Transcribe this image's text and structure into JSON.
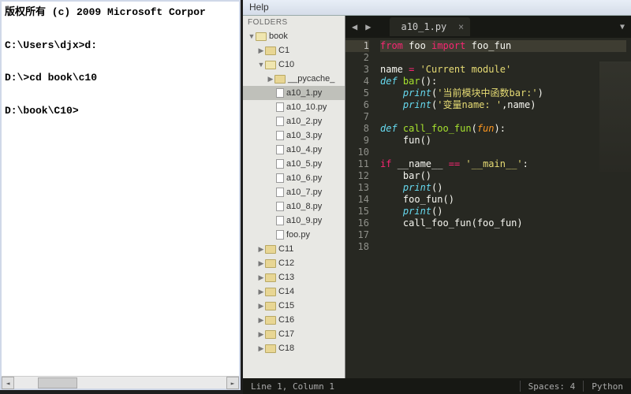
{
  "terminal": {
    "line1": "版权所有 (c) 2009 Microsoft Corpor",
    "line2": "C:\\Users\\djx>d:",
    "line3": "D:\\>cd book\\c10",
    "line4": "D:\\book\\C10>"
  },
  "menu": {
    "help": "Help"
  },
  "sidebar": {
    "header": "FOLDERS",
    "folders": {
      "root": "book",
      "c1": "C1",
      "c10": "C10",
      "pycache": "__pycache_",
      "c11": "C11",
      "c12": "C12",
      "c13": "C13",
      "c14": "C14",
      "c15": "C15",
      "c16": "C16",
      "c17": "C17",
      "c18": "C18"
    },
    "files": {
      "a1": "a10_1.py",
      "a10": "a10_10.py",
      "a2": "a10_2.py",
      "a3": "a10_3.py",
      "a4": "a10_4.py",
      "a5": "a10_5.py",
      "a6": "a10_6.py",
      "a7": "a10_7.py",
      "a8": "a10_8.py",
      "a9": "a10_9.py",
      "foo": "foo.py"
    }
  },
  "tab": {
    "title": "a10_1.py",
    "nav_prev": "◀",
    "nav_next": "▶",
    "overflow": "▼"
  },
  "gutter": [
    "1",
    "2",
    "3",
    "4",
    "5",
    "6",
    "7",
    "8",
    "9",
    "10",
    "11",
    "12",
    "13",
    "14",
    "15",
    "16",
    "17",
    "18"
  ],
  "code": {
    "l1": {
      "from": "from",
      "foo": " foo ",
      "import": "import",
      "fun": " foo_fun"
    },
    "l3": {
      "name": "name ",
      "eq": "=",
      "str": " 'Current module'"
    },
    "l4": {
      "def": "def ",
      "bar": "bar",
      "paren": "():"
    },
    "l5": {
      "indent": "    ",
      "print": "print",
      "open": "(",
      "str": "'当前模块中函数bar:'",
      "close": ")"
    },
    "l6": {
      "indent": "    ",
      "print": "print",
      "open": "(",
      "str": "'变量name: '",
      "comma": ",name)"
    },
    "l8": {
      "def": "def ",
      "call": "call_foo_fun",
      "open": "(",
      "fun": "fun",
      "close": "):"
    },
    "l9": {
      "indent": "    ",
      "fun": "fun()"
    },
    "l11": {
      "if": "if ",
      "name": "__name__ ",
      "eq": "==",
      "str": " '__main__'",
      "colon": ":"
    },
    "l12": {
      "indent": "    ",
      "bar": "bar()"
    },
    "l13": {
      "indent": "    ",
      "print": "print",
      "paren": "()"
    },
    "l14": {
      "indent": "    ",
      "foo": "foo_fun()"
    },
    "l15": {
      "indent": "    ",
      "print": "print",
      "paren": "()"
    },
    "l16": {
      "indent": "    ",
      "call": "call_foo_fun(foo_fun)"
    }
  },
  "status": {
    "pos": "Line 1, Column 1",
    "spaces": "Spaces: 4",
    "lang": "Python"
  }
}
